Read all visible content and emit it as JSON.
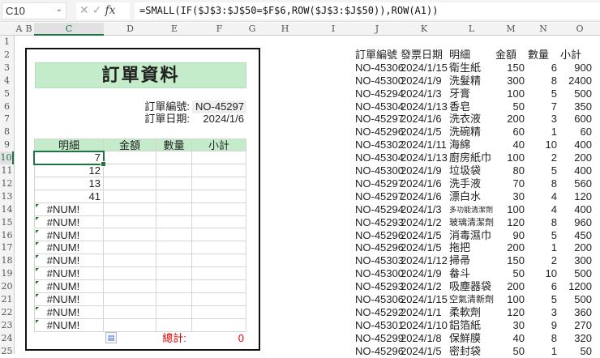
{
  "formula_bar": {
    "name_box": "C10",
    "fx": "fx",
    "formula": "=SMALL(IF($J$3:$J$50=$F$6,ROW($J$3:$J$50)),ROW(A1))"
  },
  "columns": [
    "A",
    "B",
    "C",
    "D",
    "E",
    "F",
    "G",
    "H",
    "I",
    "J",
    "K",
    "L",
    "M",
    "N",
    "O"
  ],
  "rows": [
    "1",
    "2",
    "3",
    "4",
    "5",
    "6",
    "7",
    "8",
    "9",
    "10",
    "11",
    "12",
    "13",
    "14",
    "15",
    "16",
    "17",
    "18",
    "19",
    "20",
    "21",
    "22",
    "23",
    "24",
    "25"
  ],
  "form": {
    "title": "訂單資料",
    "order_no_label": "訂單編號:",
    "order_no": "NO-45297",
    "order_date_label": "訂單日期:",
    "order_date": "2024/1/6",
    "headers": [
      "明細",
      "金額",
      "數量",
      "小計"
    ],
    "detail_values": [
      "7",
      "12",
      "13",
      "41",
      "#NUM!",
      "#NUM!",
      "#NUM!",
      "#NUM!",
      "#NUM!",
      "#NUM!",
      "#NUM!",
      "#NUM!",
      "#NUM!",
      "#NUM!"
    ],
    "total_label": "總計:",
    "total": "0"
  },
  "source": {
    "headers": [
      "訂單編號",
      "發票日期",
      "明細",
      "金額",
      "數量",
      "小計"
    ],
    "rows": [
      [
        "NO-45306",
        "2024/1/15",
        "衛生紙",
        "150",
        "6",
        "900"
      ],
      [
        "NO-45300",
        "2024/1/9",
        "洗髮精",
        "300",
        "8",
        "2400"
      ],
      [
        "NO-45294",
        "2024/1/3",
        "牙膏",
        "100",
        "5",
        "500"
      ],
      [
        "NO-45304",
        "2024/1/13",
        "香皂",
        "50",
        "7",
        "350"
      ],
      [
        "NO-45297",
        "2024/1/6",
        "洗衣液",
        "200",
        "3",
        "600"
      ],
      [
        "NO-45296",
        "2024/1/5",
        "洗碗精",
        "60",
        "1",
        "60"
      ],
      [
        "NO-45302",
        "2024/1/11",
        "海綿",
        "40",
        "10",
        "400"
      ],
      [
        "NO-45304",
        "2024/1/13",
        "廚房紙巾",
        "100",
        "2",
        "200"
      ],
      [
        "NO-45300",
        "2024/1/9",
        "垃圾袋",
        "80",
        "5",
        "400"
      ],
      [
        "NO-45297",
        "2024/1/6",
        "洗手液",
        "70",
        "8",
        "560"
      ],
      [
        "NO-45297",
        "2024/1/6",
        "漂白水",
        "30",
        "4",
        "120"
      ],
      [
        "NO-45294",
        "2024/1/3",
        "多功能清潔劑",
        "100",
        "4",
        "400"
      ],
      [
        "NO-45293",
        "2024/1/2",
        "玻璃清潔劑",
        "120",
        "8",
        "960"
      ],
      [
        "NO-45296",
        "2024/1/5",
        "消毒濕巾",
        "90",
        "5",
        "450"
      ],
      [
        "NO-45296",
        "2024/1/5",
        "拖把",
        "200",
        "1",
        "200"
      ],
      [
        "NO-45303",
        "2024/1/12",
        "掃帚",
        "150",
        "2",
        "300"
      ],
      [
        "NO-45300",
        "2024/1/9",
        "畚斗",
        "50",
        "10",
        "500"
      ],
      [
        "NO-45293",
        "2024/1/2",
        "吸塵器袋",
        "200",
        "6",
        "1200"
      ],
      [
        "NO-45306",
        "2024/1/15",
        "空氣清新劑",
        "100",
        "5",
        "500"
      ],
      [
        "NO-45292",
        "2024/1/1",
        "柔軟劑",
        "120",
        "3",
        "360"
      ],
      [
        "NO-45301",
        "2024/1/10",
        "鋁箔紙",
        "30",
        "9",
        "270"
      ],
      [
        "NO-45299",
        "2024/1/8",
        "保鮮膜",
        "40",
        "8",
        "320"
      ],
      [
        "NO-45296",
        "2024/1/5",
        "密封袋",
        "50",
        "1",
        "50"
      ]
    ]
  },
  "colors": {
    "accent": "#217346",
    "header_green": "#c4ecca",
    "total_red": "#e00000"
  }
}
